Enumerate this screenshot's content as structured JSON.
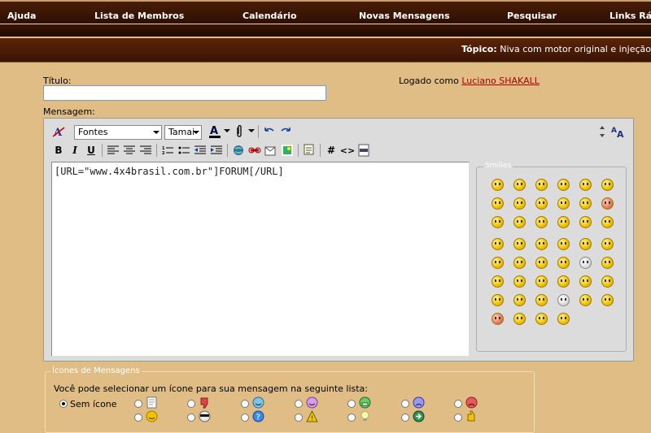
{
  "nav": {
    "items": [
      "Ajuda",
      "Lista de Membros",
      "Calendário",
      "Novas Mensagens",
      "Pesquisar",
      "Links Ráp"
    ]
  },
  "topic": {
    "label": "Tópico:",
    "title": "Niva com motor original e injeção"
  },
  "form": {
    "title_label": "Título:",
    "title_value": "",
    "logged_prefix": "Logado como",
    "user": "Luciano SHAKALL",
    "message_label": "Mensagem:"
  },
  "toolbar": {
    "font_select": "Fontes",
    "size_select": "Tamai",
    "buttons_row2": [
      "B",
      "I",
      "U"
    ],
    "hash": "#",
    "code": "<>"
  },
  "message": {
    "text": "[URL=\"www.4x4brasil.com.br\"]FORUM[/URL]"
  },
  "smilies": {
    "legend": "Smilies",
    "count": 46
  },
  "icons": {
    "legend": "Ícones de Mensagens",
    "description": "Você pode selecionar um ícone para sua mensagem na seguinte lista:",
    "none_label": "Sem ícone",
    "row1": [
      "document-icon",
      "thumbs-down-icon",
      "smile-icon",
      "purple-smile-icon",
      "grin-icon",
      "sad-icon",
      "angry-icon"
    ],
    "row2": [
      "yellow-smile-icon",
      "cool-icon",
      "question-icon",
      "warning-icon",
      "lightbulb-icon",
      "arrow-right-icon",
      "thumbs-up-icon"
    ]
  }
}
